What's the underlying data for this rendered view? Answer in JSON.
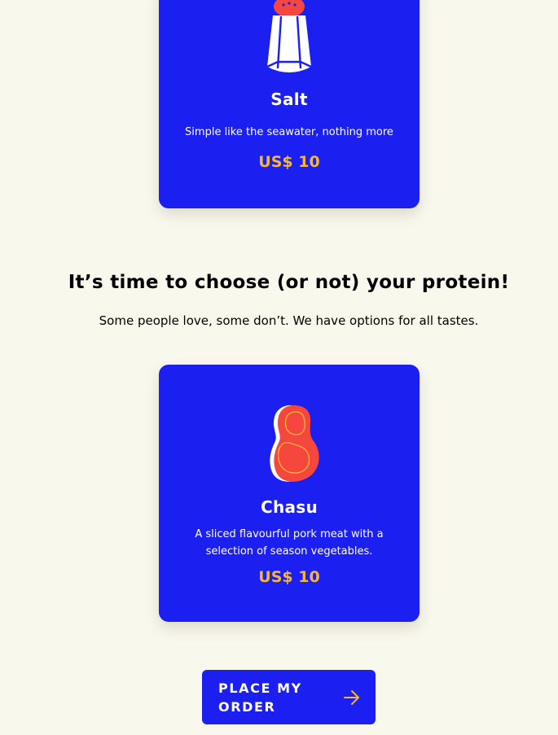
{
  "broth_card": {
    "icon": "salt-shaker-icon",
    "title": "Salt",
    "description": "Simple like the seawater, nothing more",
    "price": "US$ 10"
  },
  "protein_section": {
    "heading": "It’s time to choose (or not) your protein!",
    "subheading": "Some people love, some don’t. We have options for all tastes."
  },
  "protein_card": {
    "icon": "chasu-meat-icon",
    "title": "Chasu",
    "description": "A sliced flavourful pork meat with a selection of season vegetables.",
    "price": "US$ 10"
  },
  "order_button": {
    "label": "PLACE MY ORDER",
    "icon": "arrow-right-icon"
  },
  "colors": {
    "background": "#f9f8ec",
    "card": "#1b1ff0",
    "price": "#f7b633",
    "accent_red": "#f5473d"
  }
}
